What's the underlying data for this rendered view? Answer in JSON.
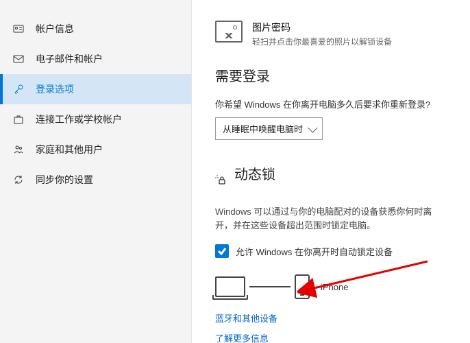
{
  "sidebar": {
    "items": [
      {
        "label": "帐户信息"
      },
      {
        "label": "电子邮件和帐户"
      },
      {
        "label": "登录选项"
      },
      {
        "label": "连接工作或学校帐户"
      },
      {
        "label": "家庭和其他用户"
      },
      {
        "label": "同步你的设置"
      }
    ]
  },
  "picture_password": {
    "title": "图片密码",
    "subtitle": "轻扫并点击你最喜爱的照片以解锁设备"
  },
  "require_signin": {
    "heading": "需要登录",
    "question": "你希望 Windows 在你离开电脑多久后要求你重新登录?",
    "select_value": "从睡眠中唤醒电脑时"
  },
  "dynamic_lock": {
    "heading": "动态锁",
    "description": "Windows 可以通过与你的电脑配对的设备获悉你何时离开，并在这些设备超出范围时锁定电脑。",
    "checkbox_label": "允许 Windows 在你离开时自动锁定设备",
    "phone_name": "iPhone",
    "link_bluetooth": "蓝牙和其他设备",
    "link_learn": "了解更多信息"
  }
}
